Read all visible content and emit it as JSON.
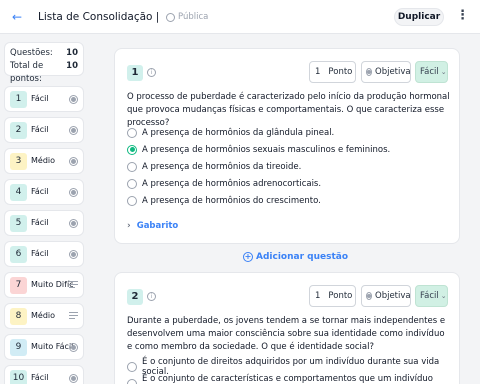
{
  "header": {
    "back_icon": "arrow-left-icon",
    "title": "Lista de Consolidação | Corpo Humano",
    "visibility": "Pública",
    "duplicate_label": "Duplicar",
    "more_icon": "more-vertical-icon"
  },
  "summary": {
    "questions_label": "Questões:",
    "questions_value": "10",
    "points_label": "Total de pontos:",
    "points_value": "10"
  },
  "questions": [
    {
      "num": "1",
      "label": "Fácil",
      "color": "#d1f0ec",
      "icon": "radio-icon"
    },
    {
      "num": "2",
      "label": "Fácil",
      "color": "#d1f0ec",
      "icon": "radio-icon"
    },
    {
      "num": "3",
      "label": "Médio",
      "color": "#fdf3c4",
      "icon": "radio-icon"
    },
    {
      "num": "4",
      "label": "Fácil",
      "color": "#d1f0ec",
      "icon": "radio-icon"
    },
    {
      "num": "5",
      "label": "Fácil",
      "color": "#d1f0ec",
      "icon": "radio-icon"
    },
    {
      "num": "6",
      "label": "Fácil",
      "color": "#d1f0ec",
      "icon": "radio-icon"
    },
    {
      "num": "7",
      "label": "Muito Difícil",
      "color": "#fbd5d5",
      "icon": "lines-icon"
    },
    {
      "num": "8",
      "label": "Médio",
      "color": "#fdf3c4",
      "icon": "lines-icon"
    },
    {
      "num": "9",
      "label": "Muito Fácil",
      "color": "#d1ecf5",
      "icon": "radio-icon"
    },
    {
      "num": "10",
      "label": "Fácil",
      "color": "#d1f0ec",
      "icon": "radio-icon"
    }
  ],
  "q1": {
    "num": "1",
    "points": "1",
    "points_label": "Ponto",
    "type": "Objetiva",
    "difficulty": "Fácil",
    "stem": "O processo de puberdade é caracterizado pelo início da produção hormonal que provoca mudanças físicas e comportamentais. O que caracteriza esse processo?",
    "options": [
      {
        "text": "A presença de hormônios da glândula pineal.",
        "selected": false
      },
      {
        "text": "A presença de hormônios sexuais masculinos e femininos.",
        "selected": true
      },
      {
        "text": "A presença de hormônios da tireoide.",
        "selected": false
      },
      {
        "text": "A presença de hormônios adrenocorticais.",
        "selected": false
      },
      {
        "text": "A presença de hormônios do crescimento.",
        "selected": false
      }
    ],
    "answer_label": "Gabarito"
  },
  "add_question": "Adicionar questão",
  "q2": {
    "num": "2",
    "points": "1",
    "points_label": "Ponto",
    "type": "Objetiva",
    "difficulty": "Fácil",
    "stem": "Durante a puberdade, os jovens tendem a se tornar mais independentes e desenvolvem uma maior consciência sobre sua identidade como indivíduo e como membro da sociedade. O que é identidade social?",
    "options": [
      {
        "text": "É o conjunto de direitos adquiridos por um indivíduo durante sua vida social.",
        "selected": false
      },
      {
        "text": "É o conjunto de características e comportamentos que um indivíduo assume",
        "selected": false
      }
    ]
  }
}
